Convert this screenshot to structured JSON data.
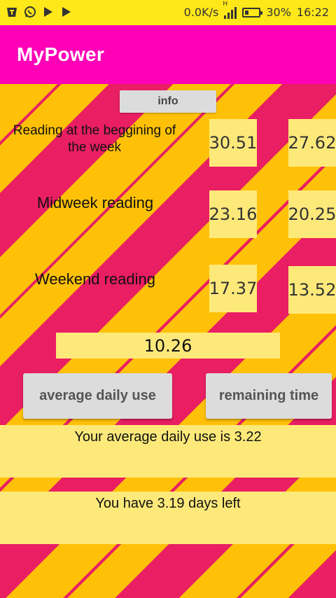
{
  "status_bar": {
    "net_speed": "0.0K/s",
    "network_type": "H",
    "battery_pct_text": "30%",
    "battery_level": 0.3,
    "time": "16:22",
    "left_icons": [
      "t-app-icon",
      "whatsapp-icon",
      "play-store-icon",
      "play-store-icon"
    ]
  },
  "app_bar": {
    "title": "MyPower",
    "color": "#ff00b7"
  },
  "info_button": {
    "label": "info"
  },
  "readings": [
    {
      "label": "Reading at the beggining of the week",
      "value_a": "30.51",
      "value_b": "27.62"
    },
    {
      "label": "Midweek reading",
      "value_a": "23.16",
      "value_b": "20.25"
    },
    {
      "label": "Weekend reading",
      "value_a": "17.37",
      "value_b": "13.52"
    }
  ],
  "result_value": "10.26",
  "buttons": {
    "average_label": "average daily use",
    "remaining_label": "remaining time"
  },
  "messages": {
    "average": "Your average daily use is 3.22",
    "remaining": "You have 3.19 days left"
  },
  "colors": {
    "status_bar": "#ffe81a",
    "stripe_orange": "#ffc107",
    "stripe_pink": "#e91e63",
    "box_yellow": "#fde97a"
  }
}
